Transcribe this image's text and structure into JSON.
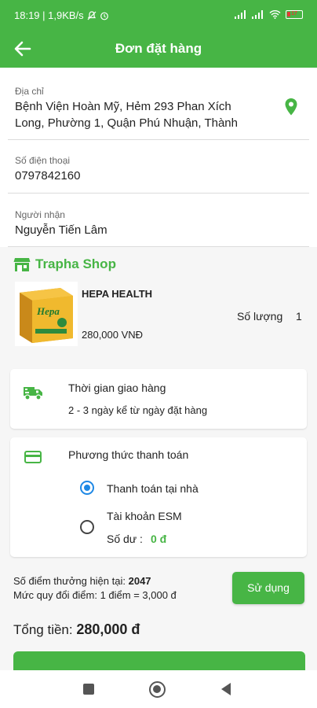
{
  "status_bar": {
    "time_info": "18:19 | 1,9KB/s",
    "battery": "17"
  },
  "app_bar": {
    "title": "Đơn đặt hàng"
  },
  "address": {
    "label": "Địa chỉ",
    "line1": "Bệnh Viện Hoàn Mỹ, Hẻm 293 Phan Xích",
    "line2": "Long, Phường 1, Quận Phú Nhuận, Thành"
  },
  "phone": {
    "label": "Số điện thoại",
    "value": "0797842160"
  },
  "receiver": {
    "label": "Người nhận",
    "value": "Nguyễn Tiến Lâm"
  },
  "shop": {
    "name": "Trapha Shop"
  },
  "product": {
    "box_text": "Hepa",
    "name": "HEPA HEALTH",
    "price": "280,000 VNĐ",
    "qty_label": "Số lượng",
    "qty_value": "1"
  },
  "delivery": {
    "title": "Thời gian giao hàng",
    "value": "2 - 3 ngày kể từ ngày đặt hàng"
  },
  "payment": {
    "title": "Phương thức thanh toán",
    "options": [
      {
        "label": "Thanh toán tại nhà",
        "selected": true
      },
      {
        "label": "Tài khoản ESM",
        "selected": false
      }
    ],
    "balance_label": "Số dư :",
    "balance_value": "0 đ"
  },
  "points": {
    "current_label": "Số điểm thưởng hiện tại:",
    "current_value": "2047",
    "rate": "Mức quy đổi điểm: 1 điểm = 3,000 đ",
    "use_button": "Sử dụng"
  },
  "total": {
    "label": "Tổng tiền:",
    "value": "280,000 đ"
  },
  "colors": {
    "accent": "#47b545",
    "radio": "#1e88e5"
  }
}
